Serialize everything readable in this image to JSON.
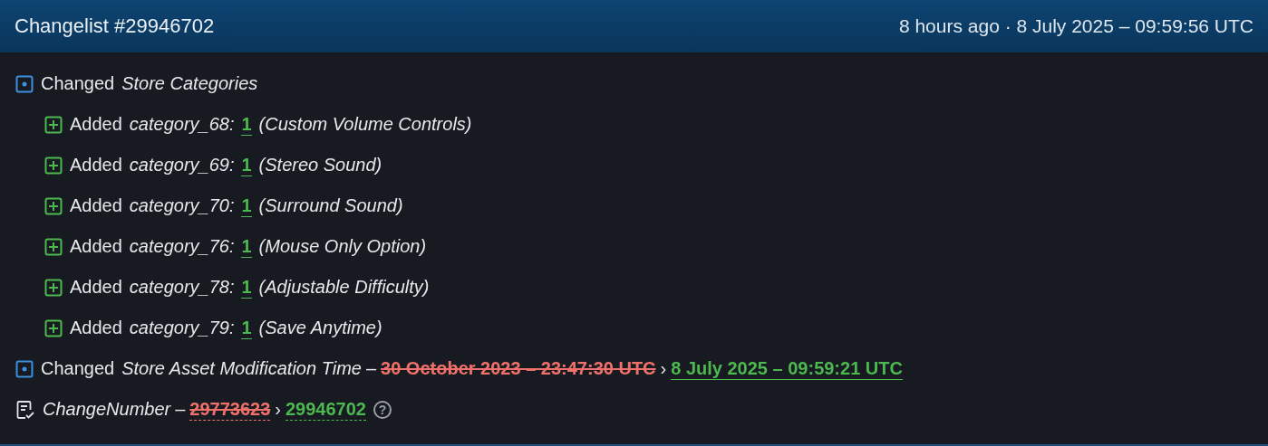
{
  "header": {
    "title": "Changelist #29946702",
    "time": "8 hours ago · 8 July 2025 – 09:59:56 UTC"
  },
  "entries": [
    {
      "kind": "changed",
      "action": "Changed",
      "name": "Store Categories",
      "children": [
        {
          "kind": "added",
          "action": "Added",
          "name": "category_68:",
          "value": "1",
          "note": "(Custom Volume Controls)"
        },
        {
          "kind": "added",
          "action": "Added",
          "name": "category_69:",
          "value": "1",
          "note": "(Stereo Sound)"
        },
        {
          "kind": "added",
          "action": "Added",
          "name": "category_70:",
          "value": "1",
          "note": "(Surround Sound)"
        },
        {
          "kind": "added",
          "action": "Added",
          "name": "category_76:",
          "value": "1",
          "note": "(Mouse Only Option)"
        },
        {
          "kind": "added",
          "action": "Added",
          "name": "category_78:",
          "value": "1",
          "note": "(Adjustable Difficulty)"
        },
        {
          "kind": "added",
          "action": "Added",
          "name": "category_79:",
          "value": "1",
          "note": "(Save Anytime)"
        }
      ]
    },
    {
      "kind": "changed",
      "action": "Changed",
      "name": "Store Asset Modification Time",
      "separator": "–",
      "old": "30 October 2023 – 23:47:30 UTC",
      "arrow": "›",
      "new": "8 July 2025 – 09:59:21 UTC"
    },
    {
      "kind": "key",
      "name": "ChangeNumber",
      "separator": "–",
      "old": "29773623",
      "arrow": "›",
      "new": "29946702",
      "help": "?"
    }
  ]
}
